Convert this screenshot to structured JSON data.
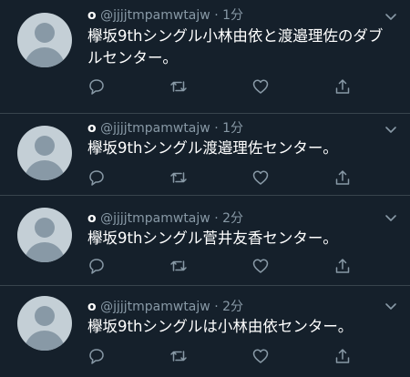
{
  "tweets": [
    {
      "name": "o",
      "handle": "@jjjjtmpamwtajw",
      "separator": "·",
      "time": "1分",
      "text": "欅坂9thシングル小林由依と渡邉理佐のダブルセンター。"
    },
    {
      "name": "o",
      "handle": "@jjjjtmpamwtajw",
      "separator": "·",
      "time": "1分",
      "text": "欅坂9thシングル渡邉理佐センター。"
    },
    {
      "name": "o",
      "handle": "@jjjjtmpamwtajw",
      "separator": "·",
      "time": "2分",
      "text": "欅坂9thシングル菅井友香センター。"
    },
    {
      "name": "o",
      "handle": "@jjjjtmpamwtajw",
      "separator": "·",
      "time": "2分",
      "text": "欅坂9thシングルは小林由依センター。"
    }
  ],
  "icons": {
    "reply": "reply-icon",
    "retweet": "retweet-icon",
    "like": "heart-icon",
    "share": "share-icon",
    "menu": "chevron-down-icon"
  },
  "colors": {
    "background": "#15202b",
    "secondary_text": "#8899a6",
    "divider": "#38444d",
    "avatar_bg": "#c4cfd6",
    "avatar_fg": "#8899a6"
  }
}
